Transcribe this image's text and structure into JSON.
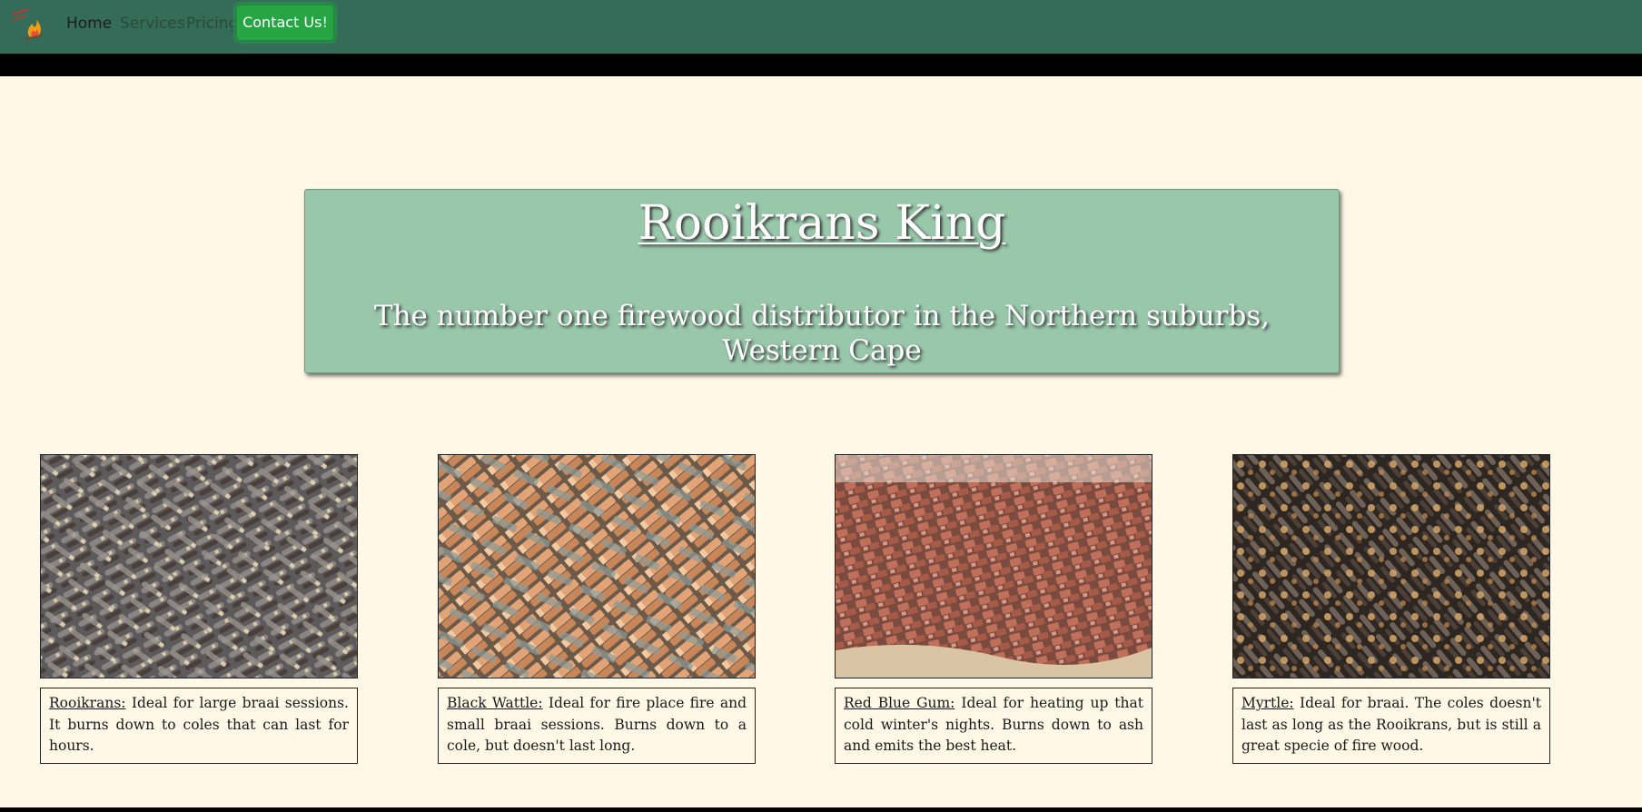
{
  "navbar": {
    "logo_icon": "campfire-logo-icon",
    "links": [
      {
        "label": "Home"
      },
      {
        "label": "Services"
      },
      {
        "label": "Pricing"
      }
    ],
    "contact_label": "Contact Us!",
    "background_color": "#356b59",
    "contact_color": "#27a544"
  },
  "hero": {
    "title": "Rooikrans King",
    "subtitle": "The number one firewood distributor in the Northern suburbs, Western Cape",
    "background_color": "#98c7aa"
  },
  "cards": [
    {
      "image_icon": "rooikrans-firewood-photo",
      "name": "Rooikrans:",
      "description": " Ideal for large braai sessions. It burns down to coles that can last for hours."
    },
    {
      "image_icon": "black-wattle-firewood-photo",
      "name": "Black Wattle:",
      "description": " Ideal for fire place fire and small braai sessions. Burns down to a cole, but doesn't last long."
    },
    {
      "image_icon": "red-blue-gum-firewood-photo",
      "name": "Red Blue Gum:",
      "description": " Ideal for heating up that cold winter's nights. Burns down to ash and emits the best heat."
    },
    {
      "image_icon": "myrtle-firewood-photo",
      "name": "Myrtle:",
      "description": " Ideal for braai. The coles doesn't last as long as the Rooikrans, but is still a great specie of fire wood."
    }
  ],
  "page_background": "#fff8e6"
}
